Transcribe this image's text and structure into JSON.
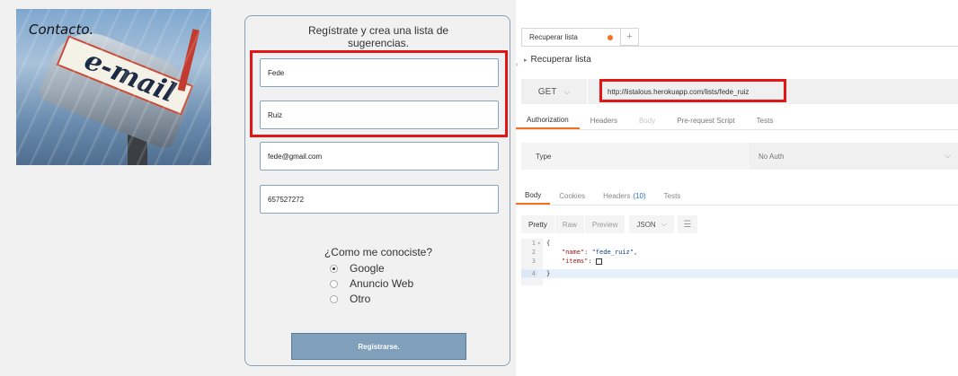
{
  "contact": {
    "title": "Contacto.",
    "logo_text": "e-mail"
  },
  "form": {
    "heading_line1": "Regístrate y crea una lista de",
    "heading_line2": "sugerencias.",
    "first_name": "Fede",
    "last_name": "Ruiz",
    "email": "fede@gmail.com",
    "phone": "657527272",
    "question": "¿Como me conociste?",
    "options": [
      {
        "label": "Google",
        "checked": true
      },
      {
        "label": "Anuncio Web",
        "checked": false
      },
      {
        "label": "Otro",
        "checked": false
      }
    ],
    "submit_label": "Registrarse."
  },
  "client": {
    "tab_label": "Recuperar lista",
    "new_tab_label": "+",
    "request_name": "Recuperar lista",
    "method": "GET",
    "url": "http://listalous.herokuapp.com/lists/fede_ruiz",
    "request_tabs": [
      "Authorization",
      "Headers",
      "Body",
      "Pre-request Script",
      "Tests"
    ],
    "auth_type_label": "Type",
    "auth_type_value": "No Auth",
    "response_tabs": {
      "body": "Body",
      "cookies": "Cookies",
      "headers": "Headers",
      "headers_count": "(10)",
      "tests": "Tests"
    },
    "format_buttons": [
      "Pretty",
      "Raw",
      "Preview"
    ],
    "format_select": "JSON",
    "code": {
      "line_numbers": [
        "1",
        "2",
        "3",
        "4"
      ],
      "open_brace": "{",
      "name_key": "\"name\"",
      "name_value": "\"fede_ruiz\"",
      "items_key": "\"items\"",
      "close_brace": "}"
    }
  },
  "colors": {
    "accent": "#f47023",
    "highlight": "#e21616",
    "submit": "#7f9fbb"
  }
}
